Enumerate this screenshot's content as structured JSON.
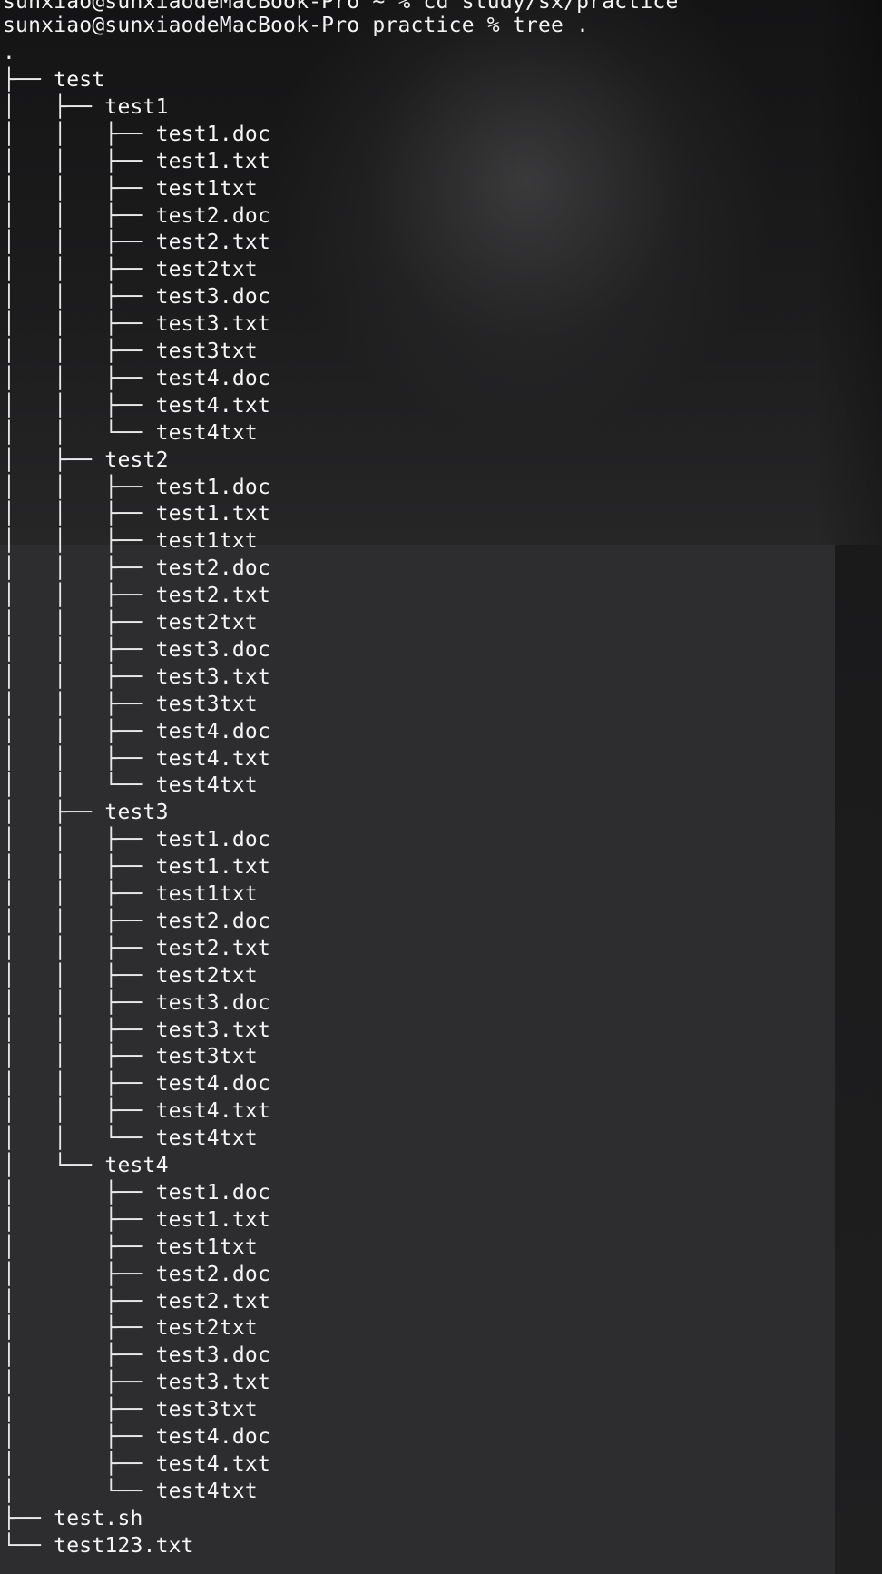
{
  "terminal": {
    "cut_off_line": "sunxiao@sunxiaodeMacBook-Pro ~ % cd study/sx/practice",
    "prompt": "sunxiao@sunxiaodeMacBook-Pro practice %",
    "command": "tree .",
    "root": ".",
    "tree_lines": [
      {
        "branch": "├── ",
        "name": "test"
      },
      {
        "branch": "│   ├── ",
        "name": "test1"
      },
      {
        "branch": "│   │   ├── ",
        "name": "test1.doc"
      },
      {
        "branch": "│   │   ├── ",
        "name": "test1.txt"
      },
      {
        "branch": "│   │   ├── ",
        "name": "test1txt"
      },
      {
        "branch": "│   │   ├── ",
        "name": "test2.doc"
      },
      {
        "branch": "│   │   ├── ",
        "name": "test2.txt"
      },
      {
        "branch": "│   │   ├── ",
        "name": "test2txt"
      },
      {
        "branch": "│   │   ├── ",
        "name": "test3.doc"
      },
      {
        "branch": "│   │   ├── ",
        "name": "test3.txt"
      },
      {
        "branch": "│   │   ├── ",
        "name": "test3txt"
      },
      {
        "branch": "│   │   ├── ",
        "name": "test4.doc"
      },
      {
        "branch": "│   │   ├── ",
        "name": "test4.txt"
      },
      {
        "branch": "│   │   └── ",
        "name": "test4txt"
      },
      {
        "branch": "│   ├── ",
        "name": "test2"
      },
      {
        "branch": "│   │   ├── ",
        "name": "test1.doc"
      },
      {
        "branch": "│   │   ├── ",
        "name": "test1.txt"
      },
      {
        "branch": "│   │   ├── ",
        "name": "test1txt"
      },
      {
        "branch": "│   │   ├── ",
        "name": "test2.doc"
      },
      {
        "branch": "│   │   ├── ",
        "name": "test2.txt"
      },
      {
        "branch": "│   │   ├── ",
        "name": "test2txt"
      },
      {
        "branch": "│   │   ├── ",
        "name": "test3.doc"
      },
      {
        "branch": "│   │   ├── ",
        "name": "test3.txt"
      },
      {
        "branch": "│   │   ├── ",
        "name": "test3txt"
      },
      {
        "branch": "│   │   ├── ",
        "name": "test4.doc"
      },
      {
        "branch": "│   │   ├── ",
        "name": "test4.txt"
      },
      {
        "branch": "│   │   └── ",
        "name": "test4txt"
      },
      {
        "branch": "│   ├── ",
        "name": "test3"
      },
      {
        "branch": "│   │   ├── ",
        "name": "test1.doc"
      },
      {
        "branch": "│   │   ├── ",
        "name": "test1.txt"
      },
      {
        "branch": "│   │   ├── ",
        "name": "test1txt"
      },
      {
        "branch": "│   │   ├── ",
        "name": "test2.doc"
      },
      {
        "branch": "│   │   ├── ",
        "name": "test2.txt"
      },
      {
        "branch": "│   │   ├── ",
        "name": "test2txt"
      },
      {
        "branch": "│   │   ├── ",
        "name": "test3.doc"
      },
      {
        "branch": "│   │   ├── ",
        "name": "test3.txt"
      },
      {
        "branch": "│   │   ├── ",
        "name": "test3txt"
      },
      {
        "branch": "│   │   ├── ",
        "name": "test4.doc"
      },
      {
        "branch": "│   │   ├── ",
        "name": "test4.txt"
      },
      {
        "branch": "│   │   └── ",
        "name": "test4txt"
      },
      {
        "branch": "│   └── ",
        "name": "test4"
      },
      {
        "branch": "│       ├── ",
        "name": "test1.doc"
      },
      {
        "branch": "│       ├── ",
        "name": "test1.txt"
      },
      {
        "branch": "│       ├── ",
        "name": "test1txt"
      },
      {
        "branch": "│       ├── ",
        "name": "test2.doc"
      },
      {
        "branch": "│       ├── ",
        "name": "test2.txt"
      },
      {
        "branch": "│       ├── ",
        "name": "test2txt"
      },
      {
        "branch": "│       ├── ",
        "name": "test3.doc"
      },
      {
        "branch": "│       ├── ",
        "name": "test3.txt"
      },
      {
        "branch": "│       ├── ",
        "name": "test3txt"
      },
      {
        "branch": "│       ├── ",
        "name": "test4.doc"
      },
      {
        "branch": "│       ├── ",
        "name": "test4.txt"
      },
      {
        "branch": "│       └── ",
        "name": "test4txt"
      },
      {
        "branch": "├── ",
        "name": "test.sh"
      },
      {
        "branch": "└── ",
        "name": "test123.txt"
      }
    ]
  }
}
